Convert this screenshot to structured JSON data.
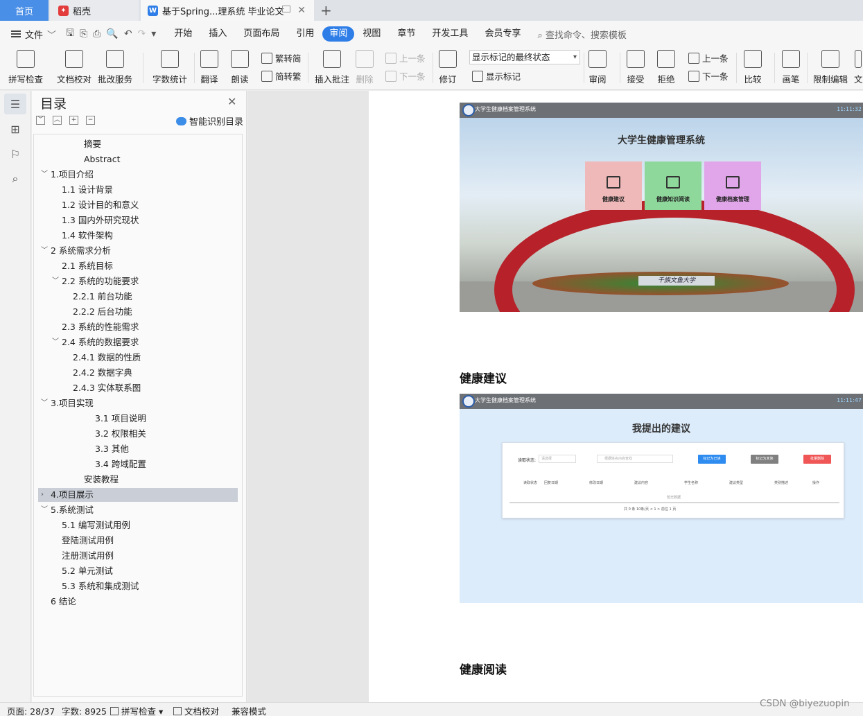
{
  "tabs": {
    "home": "首页",
    "daoke": "稻壳",
    "doc": "基于Spring...理系统 毕业论文"
  },
  "menu": {
    "file": "文件",
    "items": [
      "开始",
      "插入",
      "页面布局",
      "引用",
      "审阅",
      "视图",
      "章节",
      "开发工具",
      "会员专享"
    ],
    "active": "审阅",
    "search": "查找命令、搜索模板"
  },
  "ribbon": {
    "spell": "拼写检查",
    "proof": "文档校对",
    "batch": "批改服务",
    "wordcount": "字数统计",
    "translate": "翻译",
    "read": "朗读",
    "trad": "繁转简",
    "simp": "简转繁",
    "insert_comment": "插入批注",
    "delete": "删除",
    "prev_comment": "上一条",
    "next_comment": "下一条",
    "revise": "修订",
    "markup_state": "显示标记的最终状态",
    "show_markup": "显示标记",
    "review": "审阅",
    "accept": "接受",
    "reject": "拒绝",
    "prev": "上一条",
    "next": "下一条",
    "compare": "比较",
    "pen": "画笔",
    "restrict": "限制编辑",
    "doc_cut": "文"
  },
  "toc": {
    "title": "目录",
    "ai": "智能识别目录",
    "items": [
      {
        "text": "摘要"
      },
      {
        "text": "Abstract"
      },
      {
        "text": "1.项目介绍"
      },
      {
        "text": "1.1 设计背景"
      },
      {
        "text": "1.2 设计目的和意义"
      },
      {
        "text": "1.3 国内外研究现状"
      },
      {
        "text": "1.4 软件架构"
      },
      {
        "text": "2 系统需求分析"
      },
      {
        "text": "2.1 系统目标"
      },
      {
        "text": "2.2 系统的功能要求"
      },
      {
        "text": "2.2.1 前台功能"
      },
      {
        "text": "2.2.2 后台功能"
      },
      {
        "text": "2.3 系统的性能需求"
      },
      {
        "text": "2.4 系统的数据要求"
      },
      {
        "text": "2.4.1 数据的性质"
      },
      {
        "text": "2.4.2 数据字典"
      },
      {
        "text": "2.4.3 实体联系图"
      },
      {
        "text": "3.项目实现"
      },
      {
        "text": "3.1 项目说明"
      },
      {
        "text": "3.2 权限相关"
      },
      {
        "text": "3.3 其他"
      },
      {
        "text": "3.4 跨域配置"
      },
      {
        "text": "安装教程"
      },
      {
        "text": "4.项目展示"
      },
      {
        "text": "5.系统测试"
      },
      {
        "text": "5.1 编写测试用例"
      },
      {
        "text": "登陆测试用例"
      },
      {
        "text": "注册测试用例"
      },
      {
        "text": "5.2 单元测试"
      },
      {
        "text": "5.3 系统和集成测试"
      },
      {
        "text": "6 结论"
      }
    ]
  },
  "document": {
    "shot1": {
      "bar_name": "大学生健康档案管理系统",
      "bar_time": "11:11:32",
      "heading": "大学生健康管理系统",
      "tiles": [
        "健康建议",
        "健康知识阅读",
        "健康档案管理"
      ],
      "sign": "千族文鱼大学"
    },
    "section1": "健康建议",
    "shot2": {
      "bar_name": "大学生健康档案管理系统",
      "bar_time": "11:11:47",
      "heading": "我提出的建议",
      "filter_label": "读取状态:",
      "filter_placeholder": "请选择",
      "search_placeholder": "根据姓名内容查找",
      "btn_read": "标记为已读",
      "btn_unread": "标记为未读",
      "btn_delete": "批量删除",
      "columns": [
        "读取状态",
        "回复日期",
        "修改日期",
        "建议内容",
        "学生名称",
        "建议类型",
        "类别描述",
        "操作"
      ],
      "empty": "暂无数据",
      "pager": "共 0 条   10条/页   <  1  >   前往  1  页",
      "colors": {
        "btn_read": "#2e8cf0",
        "btn_unread": "#808080",
        "btn_delete": "#f05656"
      }
    },
    "section2": "健康阅读"
  },
  "status": {
    "page": "页面: 28/37",
    "words": "字数: 8925",
    "spell": "拼写检查",
    "proof": "文档校对",
    "compat": "兼容模式"
  },
  "watermark": "CSDN @biyezuopin"
}
